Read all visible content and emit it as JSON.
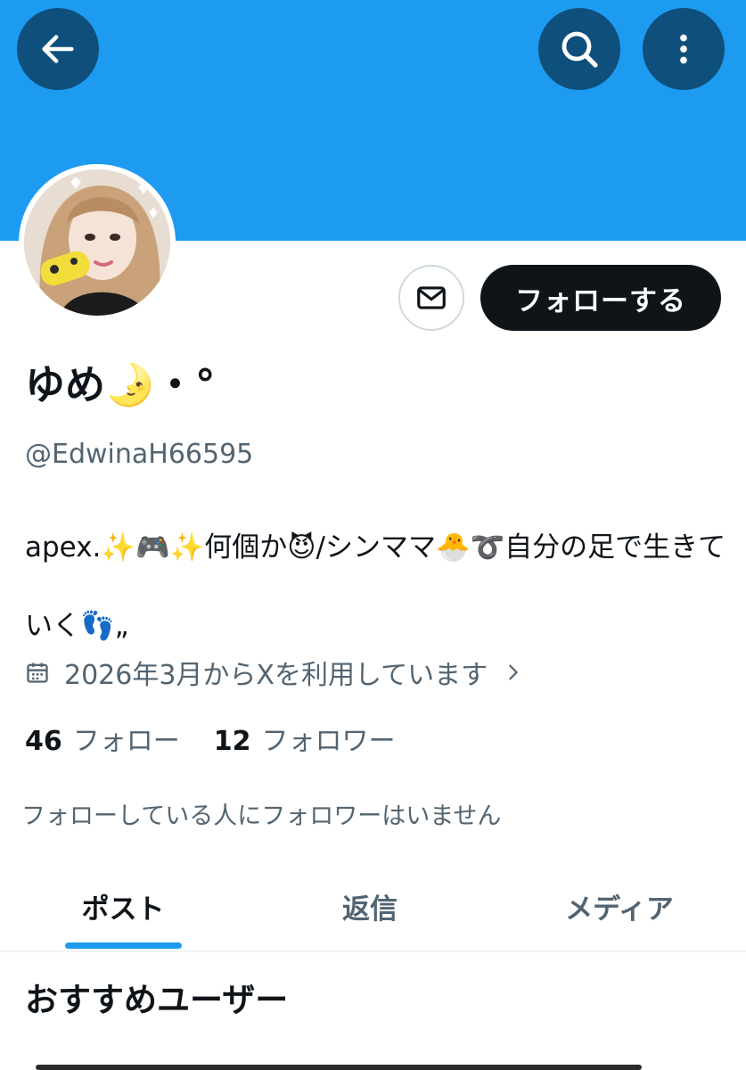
{
  "header": {
    "back_icon": "arrow-left-icon",
    "search_icon": "search-icon",
    "more_icon": "more-vertical-icon",
    "banner_color": "#1d9bf0",
    "button_color": "#0e4f7c"
  },
  "profile": {
    "display_name": "ゆめ🌛・°",
    "handle": "@EdwinaH66595",
    "bio": "apex.✨🎮✨何個か😈/シンママ🐣➰自分の足で生きていく👣„",
    "joined": "2026年3月からXを利用しています",
    "following_count": "46",
    "following_label": "フォロー",
    "followers_count": "12",
    "followers_label": "フォロワー",
    "mutuals_note": "フォローしている人にフォロワーはいません"
  },
  "actions": {
    "message_icon": "envelope-icon",
    "follow_label": "フォローする"
  },
  "tabs": [
    {
      "label": "ポスト",
      "active": true
    },
    {
      "label": "返信",
      "active": false
    },
    {
      "label": "メディア",
      "active": false
    }
  ],
  "recommended": {
    "title": "おすすめユーザー"
  },
  "colors": {
    "accent": "#1d9bf0",
    "text_primary": "#0f1419",
    "text_secondary": "#536471"
  }
}
